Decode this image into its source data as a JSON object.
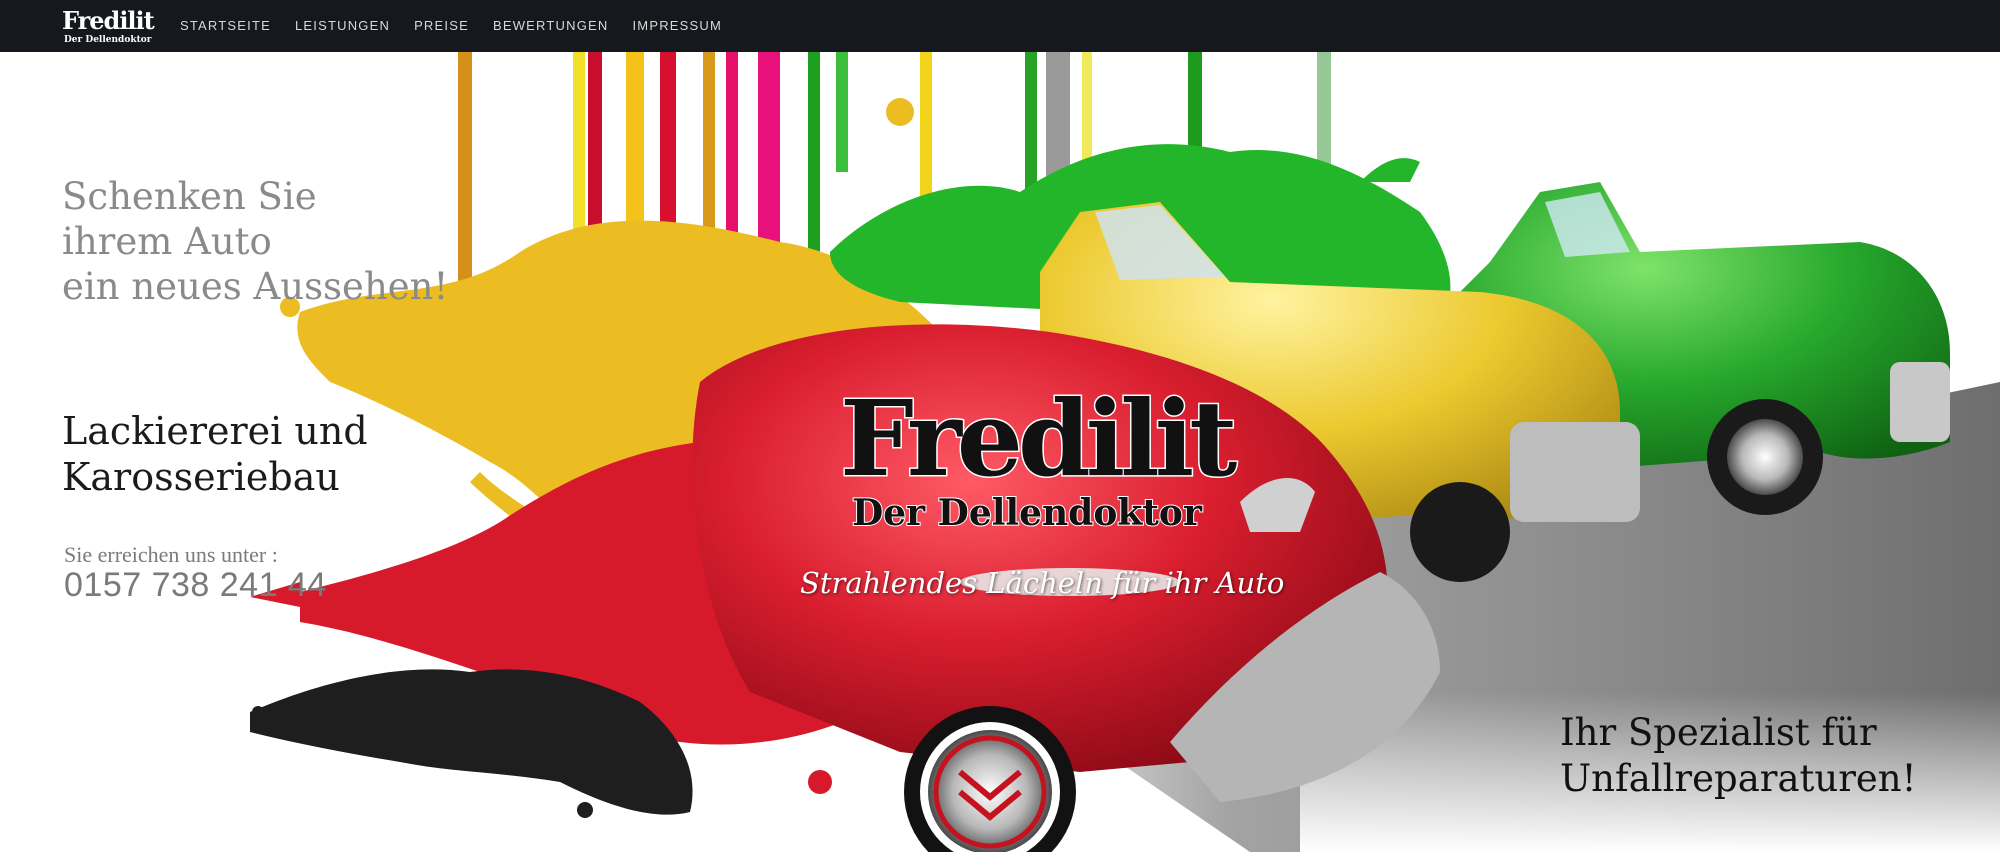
{
  "nav": {
    "logo_title": "Fredilit",
    "logo_subtitle": "Der Dellendoktor",
    "items": [
      {
        "label": "STARTSEITE"
      },
      {
        "label": "LEISTUNGEN"
      },
      {
        "label": "PREISE"
      },
      {
        "label": "BEWERTUNGEN"
      },
      {
        "label": "IMPRESSUM"
      }
    ]
  },
  "hero": {
    "slogan_lines": [
      "Schenken Sie",
      "ihrem Auto",
      "ein neues Aussehen!"
    ],
    "service_lines": [
      "Lackiererei und",
      "Karosseriebau"
    ],
    "contact_label": "Sie erreichen uns unter :",
    "phone": "0157 738 241 44",
    "brand_title": "Fredilit",
    "brand_subtitle": "Der Dellendoktor",
    "tagline": "Strahlendes Lächeln für ihr Auto",
    "specialist_lines": [
      "Ihr Spezialist für",
      "Unfallreparaturen!"
    ]
  },
  "colors": {
    "nav_background": "#15181c",
    "car_red": "#d21b2c",
    "car_yellow": "#e6c72e",
    "car_green": "#22a52a",
    "paint_black": "#1e1e1e",
    "text_gray": "#8a8a8a"
  }
}
